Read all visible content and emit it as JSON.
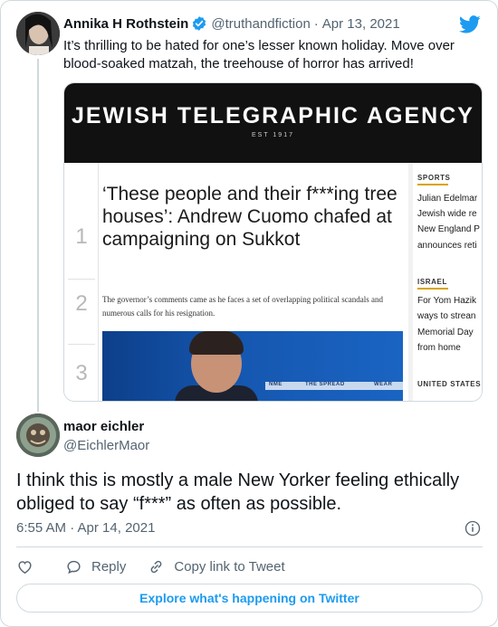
{
  "quoted_tweet": {
    "author_name": "Annika H Rothstein",
    "handle": "@truthandfiction",
    "separator": "·",
    "date": "Apr 13, 2021",
    "text": "It’s thrilling to be hated for one’s lesser known holiday. Move over blood-soaked matzah, the treehouse of horror has arrived!",
    "verified": true
  },
  "embedded_image": {
    "masthead": "JEWISH TELEGRAPHIC AGENCY",
    "established": "EST 1917",
    "headline": "‘These people and their f***ing tree houses’: Andrew Cuomo chafed at campaigning on Sukkot",
    "deck": "The governor’s comments came as he faces a set of overlapping political scandals and numerous calls for his resignation.",
    "rank_numbers": [
      "1",
      "2",
      "3"
    ],
    "photo_overlay_text": [
      "NME",
      "THE SPREAD",
      "WEAR"
    ],
    "sidebar": {
      "sections": [
        {
          "label": "SPORTS",
          "lines": [
            "Julian Edelmar",
            "Jewish wide re",
            "New England P",
            "announces reti"
          ]
        },
        {
          "label": "ISRAEL",
          "lines": [
            "For Yom Hazik",
            "ways to strean",
            "Memorial Day",
            "from home"
          ]
        },
        {
          "label": "UNITED STATES",
          "lines": []
        }
      ]
    },
    "accent_color": "#d9a300"
  },
  "reply_tweet": {
    "author_name": "maor eichler",
    "handle": "@EichlerMaor",
    "text": "I think this is mostly a male New Yorker feeling ethically obliged to say “f***” as often as possible.",
    "timestamp": "6:55 AM · Apr 14, 2021"
  },
  "actions": {
    "like_icon": "heart-icon",
    "reply_label": "Reply",
    "reply_icon": "speech-bubble-icon",
    "copy_link_label": "Copy link to Tweet",
    "copy_link_icon": "link-icon"
  },
  "explore_button": "Explore what's happening on Twitter",
  "colors": {
    "twitter_blue": "#1d9bf0",
    "secondary_text": "#536471",
    "border": "#cfd9de"
  }
}
